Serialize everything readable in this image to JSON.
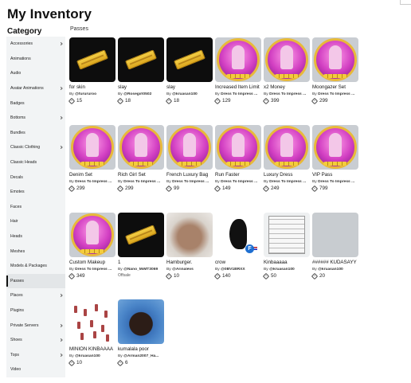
{
  "page": {
    "title": "My Inventory"
  },
  "sidebar": {
    "heading": "Category",
    "items": [
      {
        "label": "Accessories",
        "chevron": true
      },
      {
        "label": "Animations",
        "chevron": false
      },
      {
        "label": "Audio",
        "chevron": false
      },
      {
        "label": "Avatar Animations",
        "chevron": true
      },
      {
        "label": "Badges",
        "chevron": false
      },
      {
        "label": "Bottoms",
        "chevron": true
      },
      {
        "label": "Bundles",
        "chevron": false
      },
      {
        "label": "Classic Clothing",
        "chevron": true
      },
      {
        "label": "Classic Heads",
        "chevron": false
      },
      {
        "label": "Decals",
        "chevron": false
      },
      {
        "label": "Emotes",
        "chevron": false
      },
      {
        "label": "Faces",
        "chevron": false
      },
      {
        "label": "Hair",
        "chevron": false
      },
      {
        "label": "Heads",
        "chevron": false
      },
      {
        "label": "Meshes",
        "chevron": false
      },
      {
        "label": "Models & Packages",
        "chevron": false
      },
      {
        "label": "Passes",
        "chevron": false,
        "active": true
      },
      {
        "label": "Places",
        "chevron": true
      },
      {
        "label": "Plugins",
        "chevron": false
      },
      {
        "label": "Private Servers",
        "chevron": true
      },
      {
        "label": "Shoes",
        "chevron": true
      },
      {
        "label": "Tops",
        "chevron": true
      },
      {
        "label": "Video",
        "chevron": false
      }
    ]
  },
  "main": {
    "section_label": "Passes",
    "items": [
      {
        "name": "for skin",
        "by": "By",
        "creator": "@furururoo",
        "price": "15",
        "thumb": "ticket",
        "thumb_icon": "gold-ticket-icon"
      },
      {
        "name": "slay",
        "by": "By",
        "creator": "@Rosegirl0502",
        "price": "18",
        "thumb": "ticket",
        "thumb_icon": "gold-ticket-icon"
      },
      {
        "name": "slay",
        "by": "By",
        "creator": "@kruasan100",
        "price": "18",
        "thumb": "ticket",
        "thumb_icon": "gold-ticket-icon"
      },
      {
        "name": "Increased Item Limit",
        "by": "By",
        "creator": "Dress To Impress ...",
        "price": "129",
        "thumb": "pass",
        "thumb_icon": "pass-emblem-icon"
      },
      {
        "name": "x2 Money",
        "by": "By",
        "creator": "Dress To Impress ...",
        "price": "399",
        "thumb": "pass",
        "thumb_icon": "pass-emblem-icon"
      },
      {
        "name": "Moongazer Set",
        "by": "By",
        "creator": "Dress To Impress ...",
        "price": "299",
        "thumb": "pass",
        "thumb_icon": "pass-emblem-icon"
      },
      {
        "name": "Denim Set",
        "by": "By",
        "creator": "Dress To Impress ...",
        "price": "299",
        "thumb": "pass",
        "thumb_icon": "pass-emblem-icon"
      },
      {
        "name": "Rich Girl Set",
        "by": "By",
        "creator": "Dress To Impress ...",
        "price": "299",
        "thumb": "pass",
        "thumb_icon": "pass-emblem-icon"
      },
      {
        "name": "French Luxury Bag",
        "by": "By",
        "creator": "Dress To Impress ...",
        "price": "99",
        "thumb": "pass",
        "thumb_icon": "pass-emblem-icon"
      },
      {
        "name": "Run Faster",
        "by": "By",
        "creator": "Dress To Impress ...",
        "price": "149",
        "thumb": "pass",
        "thumb_icon": "pass-emblem-icon"
      },
      {
        "name": "Luxury Dress",
        "by": "By",
        "creator": "Dress To Impress ...",
        "price": "249",
        "thumb": "pass",
        "thumb_icon": "pass-emblem-icon"
      },
      {
        "name": "VIP Pass",
        "by": "By",
        "creator": "Dress To Impress ...",
        "price": "799",
        "thumb": "pass",
        "thumb_icon": "pass-emblem-icon"
      },
      {
        "name": "Custom Makeup",
        "by": "By",
        "creator": "Dress To Impress ...",
        "price": "349",
        "thumb": "pass",
        "thumb_icon": "pass-emblem-icon"
      },
      {
        "name": "1",
        "by": "By",
        "creator": "@Nano_MiMT3069",
        "price": "",
        "offsale": "Offsale",
        "thumb": "ticket",
        "thumb_icon": "gold-ticket-icon"
      },
      {
        "name": "Hamburger.",
        "by": "By",
        "creator": "@Arinalevs",
        "price": "10",
        "thumb": "burger",
        "thumb_icon": "hamburger-photo-icon"
      },
      {
        "name": "crow",
        "by": "By",
        "creator": "@0BV1BRXX",
        "price": "140",
        "thumb": "crow",
        "thumb_icon": "crow-icon"
      },
      {
        "name": "Kinbaaaaa",
        "by": "By",
        "creator": "@kruasan100",
        "price": "50",
        "thumb": "kinba",
        "thumb_icon": "document-sheet-icon"
      },
      {
        "name": "###### KUDASAYY",
        "by": "By",
        "creator": "@kruasan100",
        "price": "20",
        "thumb": "blank",
        "thumb_icon": "placeholder-icon"
      },
      {
        "name": "MINION KINBAAAA",
        "by": "By",
        "creator": "@kruasan100",
        "price": "10",
        "thumb": "minion",
        "thumb_icon": "minion-figures-icon"
      },
      {
        "name": "kumalala poor",
        "by": "By",
        "creator": "@Arman2007_Ha...",
        "price": "6",
        "thumb": "kumalala",
        "thumb_icon": "portrait-photo-icon"
      }
    ]
  }
}
